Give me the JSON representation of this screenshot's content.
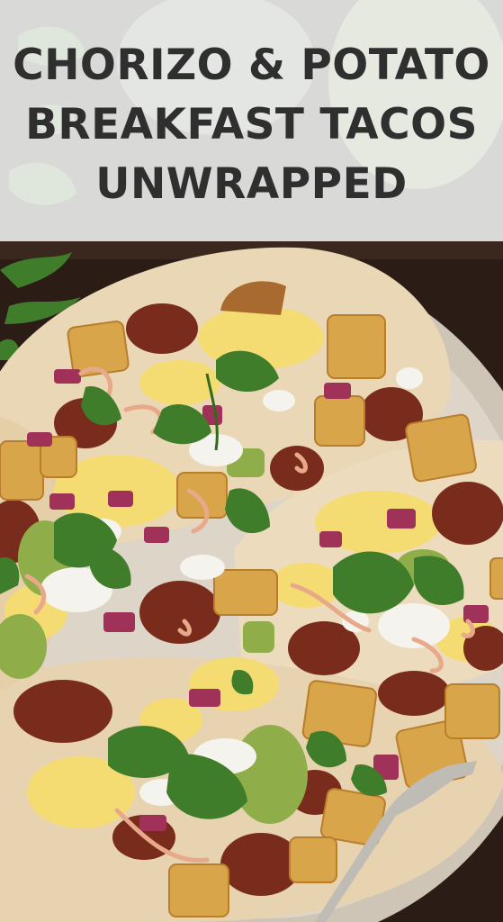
{
  "title": {
    "lines": [
      "CHORIZO & POTATO",
      "BREAKFAST TACOS",
      "UNWRAPPED"
    ]
  },
  "colors": {
    "title_text": "#2f2f2f",
    "band": "#eceeec",
    "table": "#2b1d16",
    "plate": "#cfc5b6",
    "tortilla": "#e9d7b6",
    "egg": "#f4dc73",
    "chorizo": "#7a2c1c",
    "potato": "#d9a54a",
    "onion": "#a0325a",
    "cilantro": "#3f7d2a",
    "avocado": "#8fae4a",
    "cheese": "#f5f3ee"
  }
}
